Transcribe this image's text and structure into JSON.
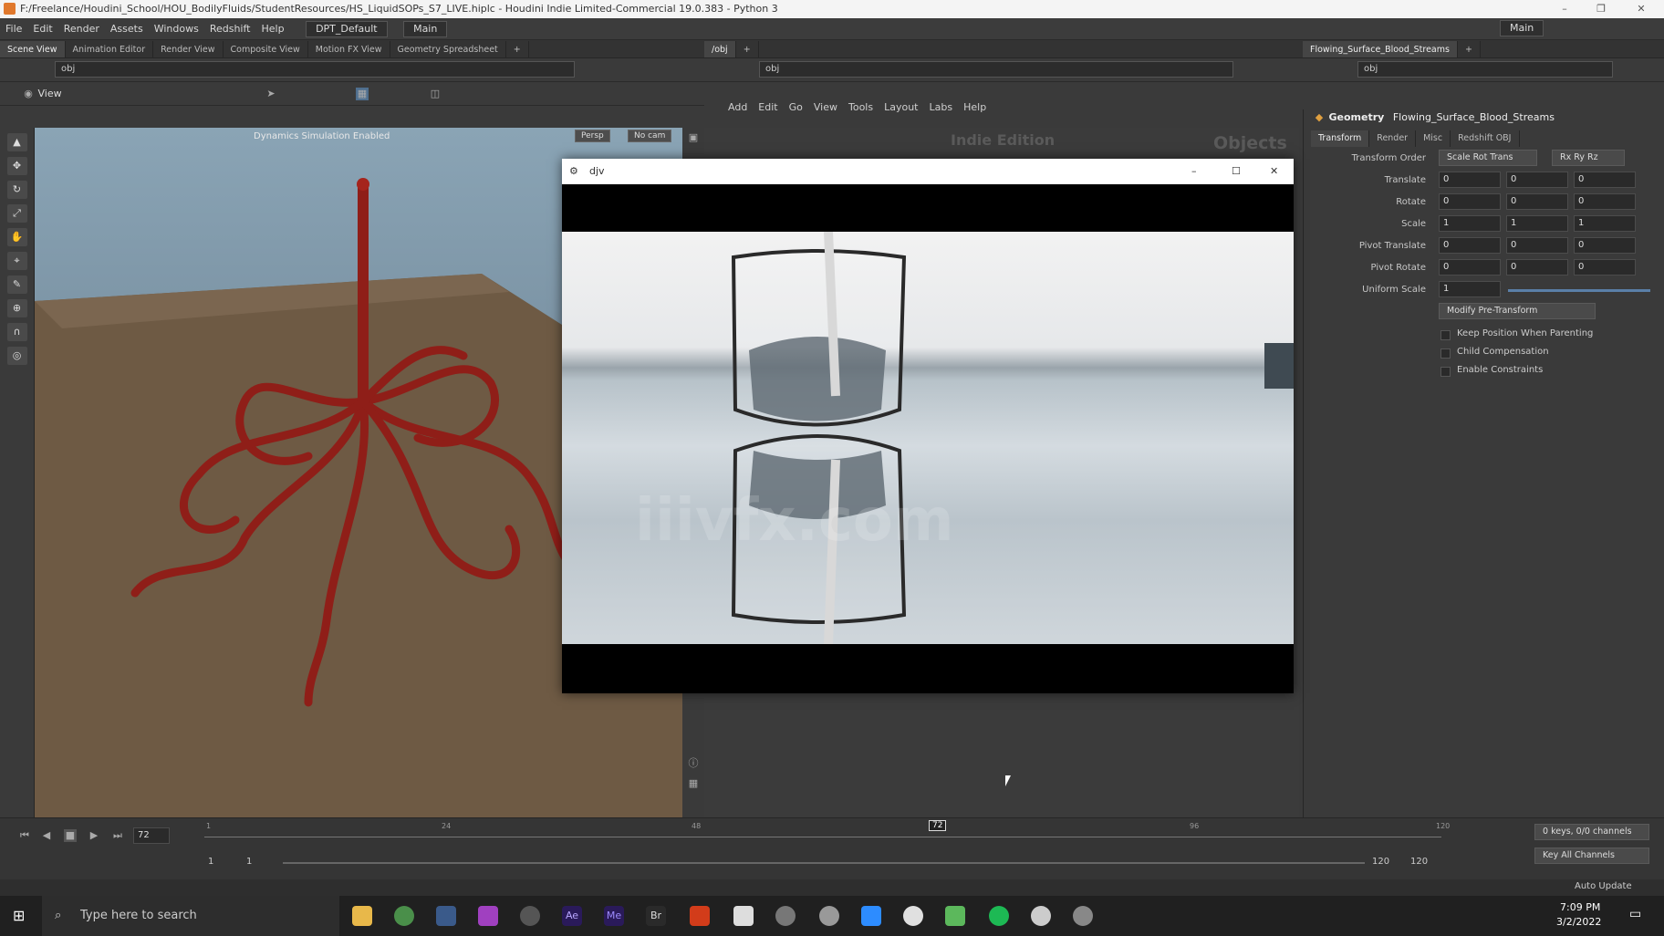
{
  "window": {
    "title": "F:/Freelance/Houdini_School/HOU_BodilyFluids/StudentResources/HS_LiquidSOPs_S7_LIVE.hiplc - Houdini Indie Limited-Commercial 19.0.383 - Python 3"
  },
  "menu": [
    "File",
    "Edit",
    "Render",
    "Assets",
    "Windows",
    "Redshift",
    "Help"
  ],
  "desktop": "DPT_Default",
  "main_label": "Main",
  "left_tabs": [
    "Scene View",
    "Animation Editor",
    "Render View",
    "Composite View",
    "Motion FX View",
    "Geometry Spreadsheet"
  ],
  "mid_tab": "/obj",
  "right_tab": "Flowing_Surface_Blood_Streams",
  "path": "obj",
  "viewport": {
    "label": "View",
    "overlay": "Dynamics Simulation Enabled",
    "persp": "Persp",
    "cam": "No cam"
  },
  "network": {
    "menu": [
      "Add",
      "Edit",
      "Go",
      "View",
      "Tools",
      "Layout",
      "Labs",
      "Help"
    ],
    "label1": "Indie Edition",
    "label2": "Objects"
  },
  "djv": {
    "title": "djv",
    "watermark": "iiivfx.com"
  },
  "params": {
    "type": "Geometry",
    "name": "Flowing_Surface_Blood_Streams",
    "tabs": [
      "Transform",
      "Render",
      "Misc",
      "Redshift OBJ"
    ],
    "transform_order_label": "Transform Order",
    "transform_order": "Scale Rot Trans",
    "rot_order": "Rx Ry Rz",
    "rows": [
      {
        "label": "Translate",
        "v": [
          "0",
          "0",
          "0"
        ]
      },
      {
        "label": "Rotate",
        "v": [
          "0",
          "0",
          "0"
        ]
      },
      {
        "label": "Scale",
        "v": [
          "1",
          "1",
          "1"
        ]
      },
      {
        "label": "Pivot Translate",
        "v": [
          "0",
          "0",
          "0"
        ]
      },
      {
        "label": "Pivot Rotate",
        "v": [
          "0",
          "0",
          "0"
        ]
      }
    ],
    "uniform_label": "Uniform Scale",
    "uniform": "1",
    "modify": "Modify Pre-Transform",
    "checks": [
      "Keep Position When Parenting",
      "Child Compensation",
      "Enable Constraints"
    ]
  },
  "timeline": {
    "frame": "72",
    "marker": "72",
    "start": "1",
    "start2": "1",
    "end": "120",
    "end2": "120",
    "ticks": [
      "1",
      "24",
      "48",
      "96",
      "120"
    ],
    "keys": "0 keys, 0/0 channels",
    "keyall": "Key All Channels",
    "auto": "Auto Update"
  },
  "taskbar": {
    "search": "Type here to search",
    "time": "7:09 PM",
    "date": "3/2/2022"
  }
}
